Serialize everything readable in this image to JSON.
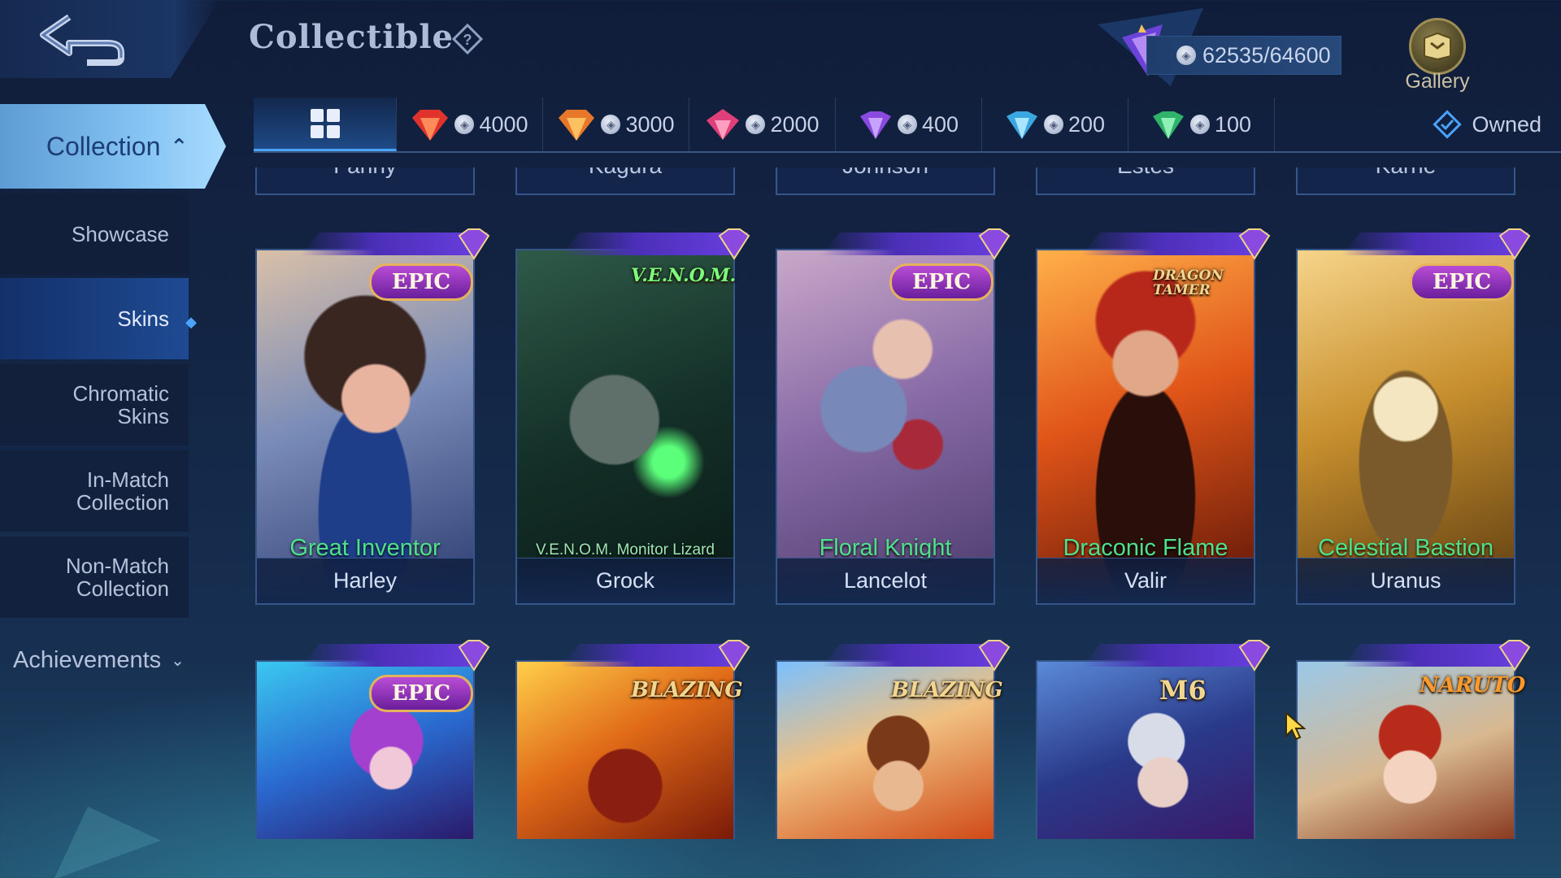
{
  "header": {
    "title": "Collectible",
    "points": "62535/64600",
    "gallery_label": "Gallery"
  },
  "tabs": [
    {
      "icon": "grid-icon",
      "label": ""
    },
    {
      "icon": "red-crystal-icon",
      "label": "4000",
      "color": "#e0332c"
    },
    {
      "icon": "orange-crystal-icon",
      "label": "3000",
      "color": "#e8772a"
    },
    {
      "icon": "pink-crystal-icon",
      "label": "2000",
      "color": "#e0407a"
    },
    {
      "icon": "purple-crystal-icon",
      "label": "400",
      "color": "#8a4ae0"
    },
    {
      "icon": "blue-crystal-icon",
      "label": "200",
      "color": "#3aa7e0"
    },
    {
      "icon": "green-crystal-icon",
      "label": "100",
      "color": "#2fb36a"
    }
  ],
  "owned_label": "Owned",
  "sidebar": {
    "collection": "Collection",
    "items": [
      {
        "label": "Showcase"
      },
      {
        "label": "Skins",
        "active": true
      },
      {
        "label": "Chromatic Skins"
      },
      {
        "label": "In-Match Collection"
      },
      {
        "label": "Non-Match Collection"
      }
    ],
    "achievements": "Achievements"
  },
  "top_partial_row": [
    "Fanny",
    "Kagura",
    "Johnson",
    "Estes",
    "Karrie"
  ],
  "cards_row1": [
    {
      "skin": "Great Inventor",
      "hero": "Harley",
      "badge": "EPIC"
    },
    {
      "skin": "V.E.N.O.M. Monitor Lizard",
      "hero": "Grock",
      "series": "V.E.N.O.M."
    },
    {
      "skin": "Floral Knight",
      "hero": "Lancelot",
      "badge": "EPIC"
    },
    {
      "skin": "Draconic Flame",
      "hero": "Valir",
      "series": "DRAGON TAMER"
    },
    {
      "skin": "Celestial Bastion",
      "hero": "Uranus",
      "badge": "EPIC"
    }
  ],
  "cards_row2": [
    {
      "badge": "EPIC"
    },
    {
      "series": "BLAZING"
    },
    {
      "series": "BLAZING"
    },
    {
      "series": "M6"
    },
    {
      "series": "NARUTO"
    }
  ],
  "colors": {
    "accent_blue": "#49a3ff",
    "skin_name_green": "#4fe08c",
    "epic_purple": "#8a2fc0"
  }
}
